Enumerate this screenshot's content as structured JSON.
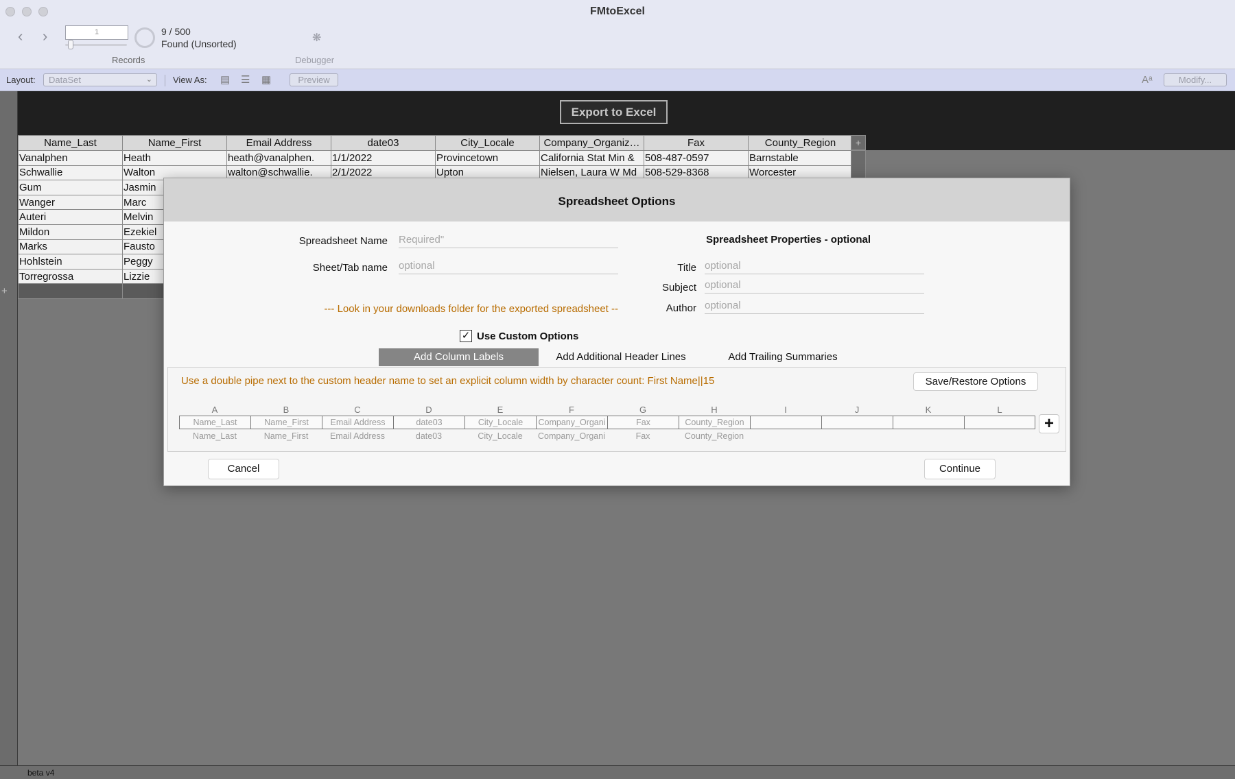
{
  "window": {
    "title": "FMtoExcel"
  },
  "toolbar": {
    "back_icon": "chevron-left-icon",
    "forward_icon": "chevron-right-icon",
    "current_record": "1",
    "found_count": "9 / 500",
    "found_state": "Found (Unsorted)",
    "records_label": "Records",
    "debugger_label": "Debugger",
    "debugger_icon": "bug-icon"
  },
  "layout_bar": {
    "layout_label": "Layout:",
    "layout_value": "DataSet",
    "view_as_label": "View As:",
    "preview_label": "Preview",
    "modify_label": "Modify..."
  },
  "header": {
    "export_button": "Export to Excel"
  },
  "table": {
    "columns": [
      "Name_Last",
      "Name_First",
      "Email Address",
      "date03",
      "City_Locale",
      "Company_Organiz…",
      "Fax",
      "County_Region"
    ],
    "rows": [
      [
        "Vanalphen",
        "Heath",
        "heath@vanalphen.",
        "1/1/2022",
        "Provincetown",
        "California Stat Min &",
        "508-487-0597",
        "Barnstable"
      ],
      [
        "Schwallie",
        "Walton",
        "walton@schwallie.",
        "2/1/2022",
        "Upton",
        "Nielsen, Laura W Md",
        "508-529-8368",
        "Worcester"
      ],
      [
        "Gum",
        "Jasmin"
      ],
      [
        "Wanger",
        "Marc"
      ],
      [
        "Auteri",
        "Melvin"
      ],
      [
        "Mildon",
        "Ezekiel"
      ],
      [
        "Marks",
        "Fausto"
      ],
      [
        "Hohlstein",
        "Peggy"
      ],
      [
        "Torregrossa",
        "Lizzie"
      ]
    ]
  },
  "dialog": {
    "title": "Spreadsheet Options",
    "spreadsheet_name_label": "Spreadsheet Name",
    "spreadsheet_name_placeholder": "Required\"",
    "sheet_tab_label": "Sheet/Tab name",
    "sheet_tab_placeholder": "optional",
    "downloads_note": "--- Look in your downloads folder for the exported spreadsheet --",
    "properties_title": "Spreadsheet  Properties - optional",
    "title_label": "Title",
    "title_placeholder": "optional",
    "subject_label": "Subject",
    "subject_placeholder": "optional",
    "author_label": "Author",
    "author_placeholder": "optional",
    "use_custom_options_label": "Use Custom Options",
    "use_custom_options_checked": true,
    "tabs": [
      "Add Column Labels",
      "Add Additional Header Lines",
      "Add Trailing Summaries"
    ],
    "active_tab": 0,
    "hint": "Use a double pipe next to the custom header name to set an explicit column width by character count: First Name||15",
    "save_restore_label": "Save/Restore Options",
    "column_letters": [
      "A",
      "B",
      "C",
      "D",
      "E",
      "F",
      "G",
      "H",
      "I",
      "J",
      "K",
      "L"
    ],
    "column_labels": [
      "Name_Last",
      "Name_First",
      "Email Address",
      "date03",
      "City_Locale",
      "Company_Organi",
      "Fax",
      "County_Region",
      "",
      "",
      "",
      ""
    ],
    "original_fields": [
      "Name_Last",
      "Name_First",
      "Email Address",
      "date03",
      "City_Locale",
      "Company_Organi",
      "Fax",
      "County_Region"
    ],
    "add_column_icon": "plus-icon",
    "cancel_label": "Cancel",
    "continue_label": "Continue"
  },
  "status": {
    "version": "beta v4"
  }
}
